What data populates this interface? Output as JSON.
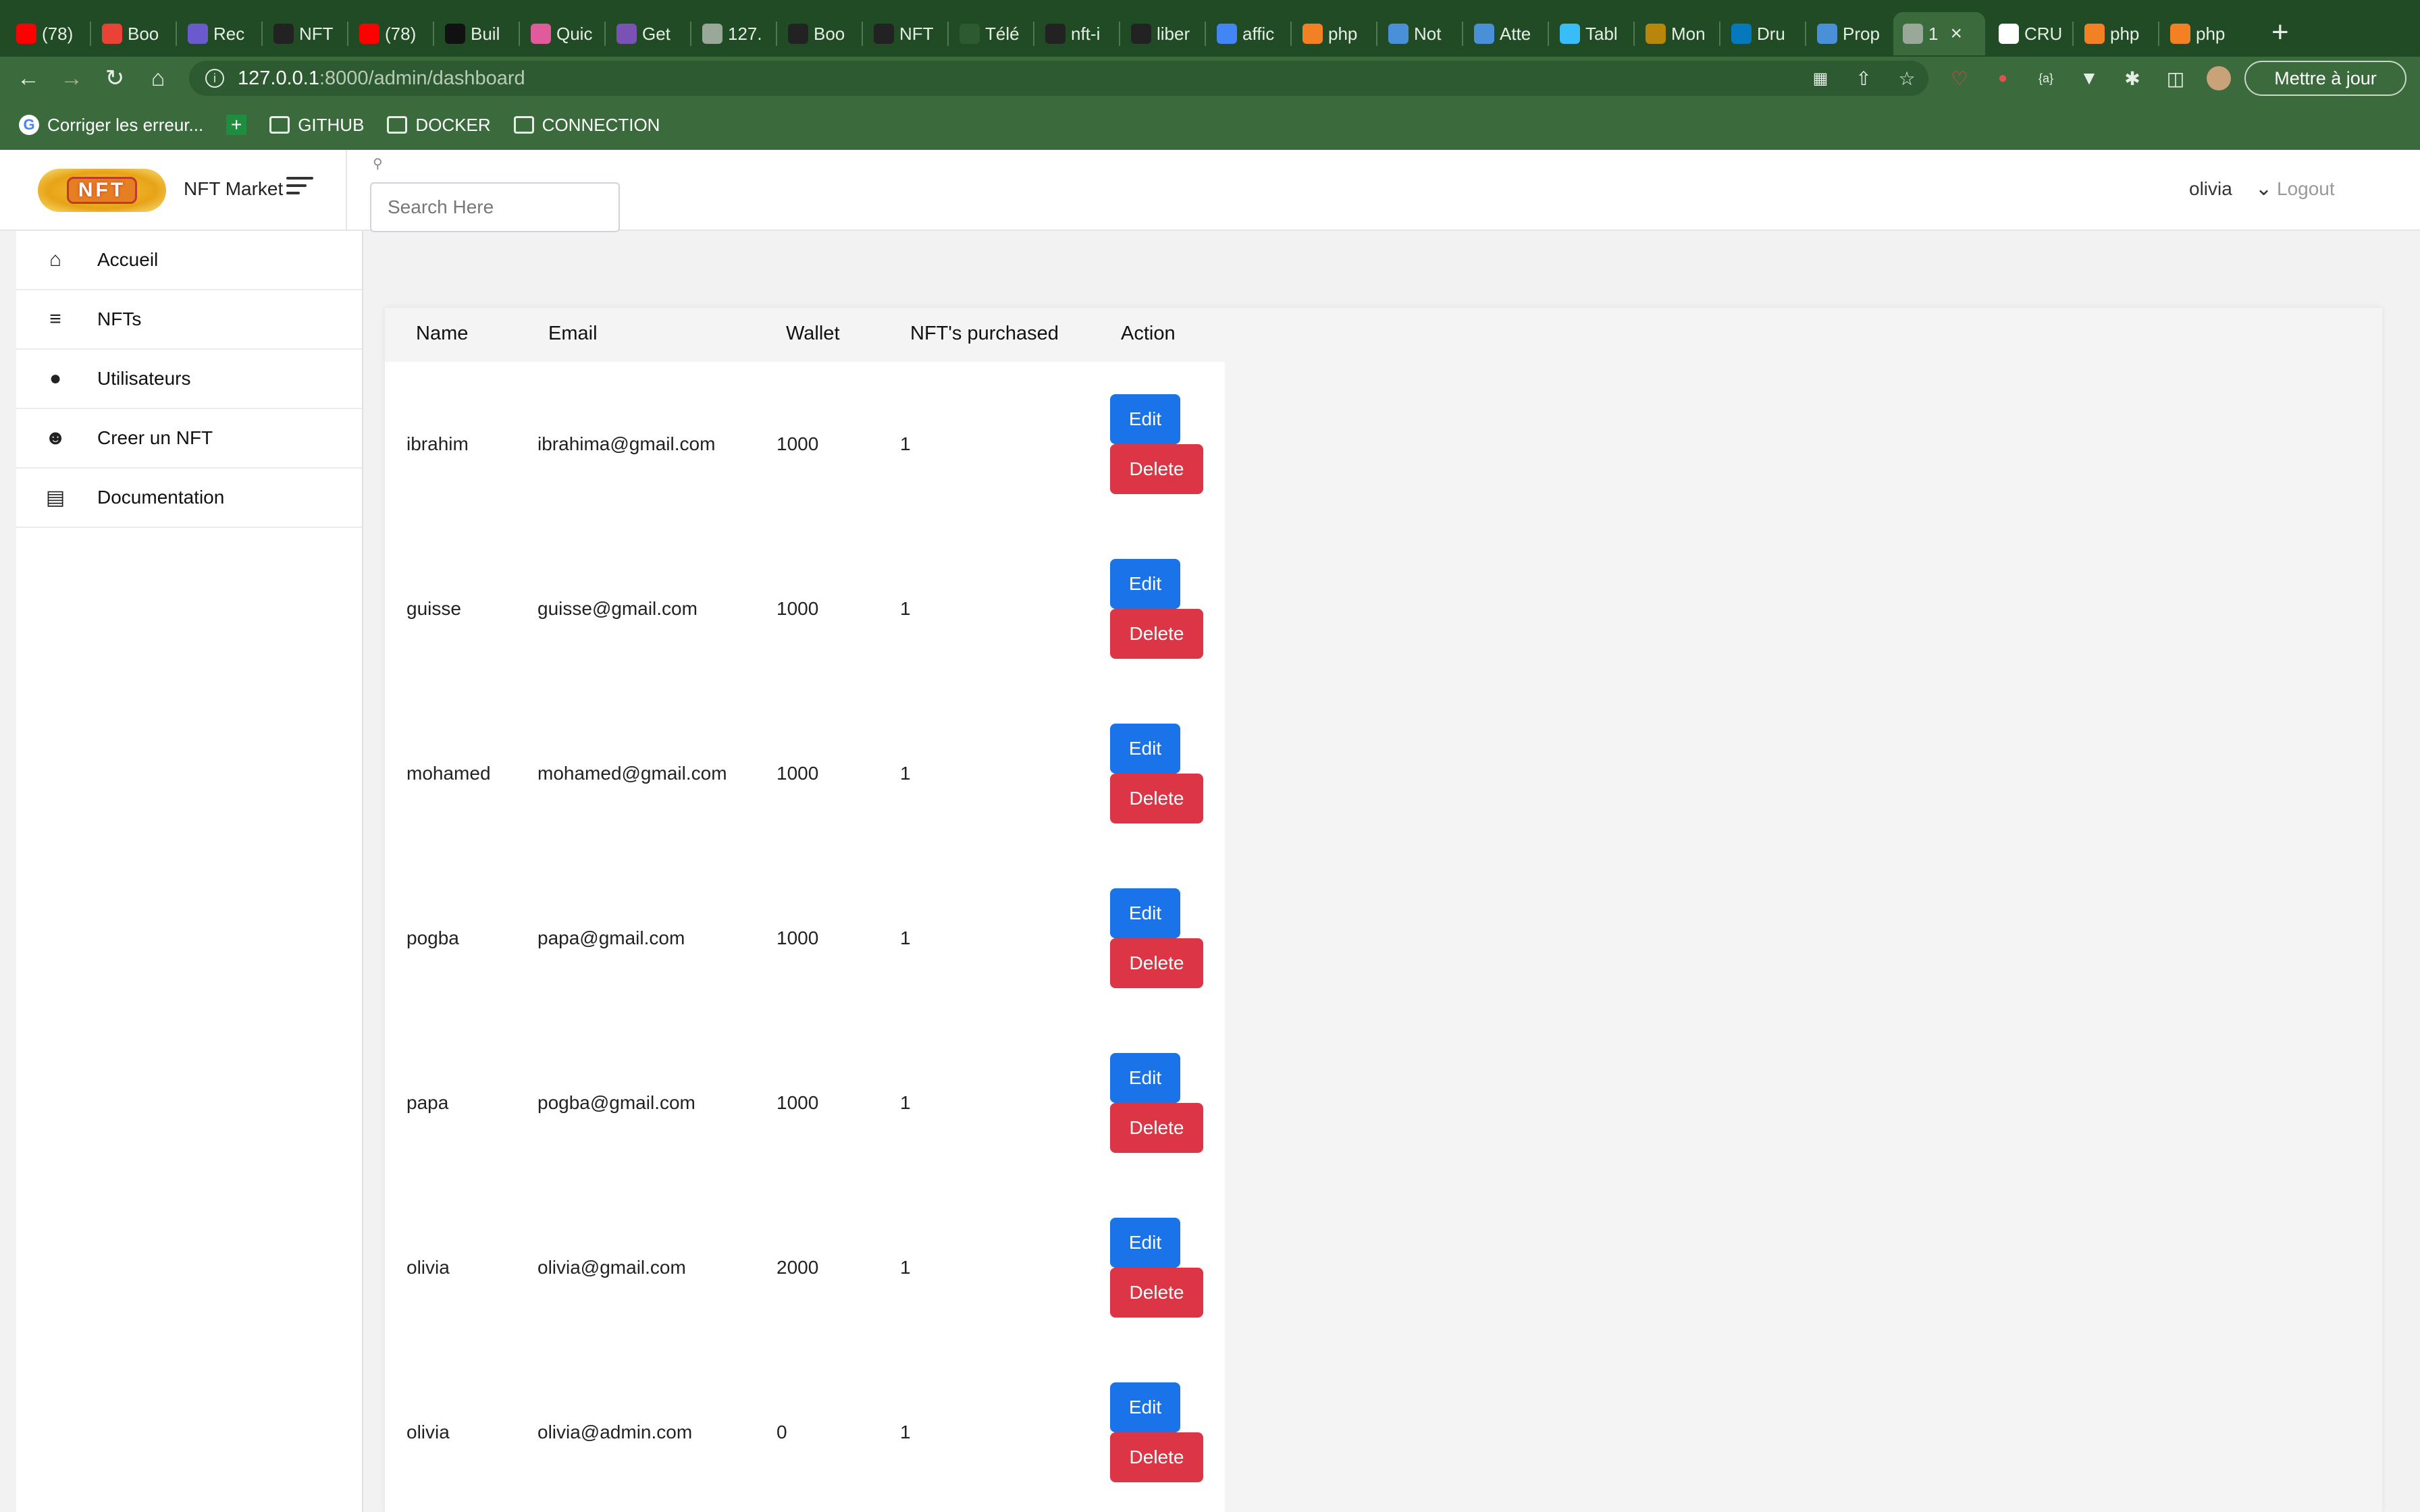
{
  "browser": {
    "tabs": [
      {
        "label": "(78)",
        "icon": "youtube-icon",
        "color": "#ff0000"
      },
      {
        "label": "Boo",
        "icon": "gmail-icon",
        "color": "#ea4335"
      },
      {
        "label": "Rec",
        "icon": "app-icon",
        "color": "#6a5acd"
      },
      {
        "label": "NFT",
        "icon": "github-icon",
        "color": "#222222"
      },
      {
        "label": "(78)",
        "icon": "youtube-icon",
        "color": "#ff0000"
      },
      {
        "label": "Buil",
        "icon": "build-icon",
        "color": "#111111"
      },
      {
        "label": "Quic",
        "icon": "quick-icon",
        "color": "#e05a9c"
      },
      {
        "label": "Get",
        "icon": "bootstrap-icon",
        "color": "#7952b3"
      },
      {
        "label": "127.",
        "icon": "page-icon",
        "color": "#9aa89a"
      },
      {
        "label": "Boo",
        "icon": "github-icon",
        "color": "#222222"
      },
      {
        "label": "NFT",
        "icon": "github-icon",
        "color": "#222222"
      },
      {
        "label": "Télé",
        "icon": "download-icon",
        "color": "#2d5a30"
      },
      {
        "label": "nft-i",
        "icon": "github-icon",
        "color": "#222222"
      },
      {
        "label": "liber",
        "icon": "github-icon",
        "color": "#222222"
      },
      {
        "label": "affic",
        "icon": "google-icon",
        "color": "#4285f4"
      },
      {
        "label": "php",
        "icon": "stackoverflow-icon",
        "color": "#f48024"
      },
      {
        "label": "Not",
        "icon": "tool-icon",
        "color": "#4a90d9"
      },
      {
        "label": "Atte",
        "icon": "tool-icon",
        "color": "#4a90d9"
      },
      {
        "label": "Tabl",
        "icon": "tailwind-icon",
        "color": "#38bdf8"
      },
      {
        "label": "Mon",
        "icon": "app-icon",
        "color": "#b8860b"
      },
      {
        "label": "Dru",
        "icon": "drupal-icon",
        "color": "#0678be"
      },
      {
        "label": "Prop",
        "icon": "tool-icon",
        "color": "#4a90d9"
      },
      {
        "label": "1",
        "icon": "page-icon",
        "color": "#9aa89a",
        "active": true
      },
      {
        "label": "CRU",
        "icon": "chat-icon",
        "color": "#ffffff"
      },
      {
        "label": "php",
        "icon": "stackoverflow-icon",
        "color": "#f48024"
      },
      {
        "label": "php",
        "icon": "stackoverflow-icon",
        "color": "#f48024"
      }
    ],
    "url_host": "127.0.0.1",
    "url_path": ":8000/admin/dashboard",
    "update_label": "Mettre à jour",
    "bookmarks": [
      {
        "label": "Corriger les erreur...",
        "icon": "google-icon"
      },
      {
        "label": "",
        "icon": "sheets-icon"
      },
      {
        "label": "GITHUB",
        "icon": "folder-icon"
      },
      {
        "label": "DOCKER",
        "icon": "folder-icon"
      },
      {
        "label": "CONNECTION",
        "icon": "folder-icon"
      }
    ]
  },
  "header": {
    "logo_text": "NFT",
    "brand_name": "NFT Market",
    "search_placeholder": "Search Here",
    "username": "olivia",
    "logout_label": "Logout"
  },
  "sidebar": {
    "items": [
      {
        "label": "Accueil",
        "icon": "home-icon"
      },
      {
        "label": "NFTs",
        "icon": "list-icon"
      },
      {
        "label": "Utilisateurs",
        "icon": "user-icon"
      },
      {
        "label": "Creer un NFT",
        "icon": "smiley-icon"
      },
      {
        "label": "Documentation",
        "icon": "document-icon"
      }
    ]
  },
  "table": {
    "columns": [
      "Name",
      "Email",
      "Wallet",
      "NFT's purchased",
      "Action"
    ],
    "edit_label": "Edit",
    "delete_label": "Delete",
    "rows": [
      {
        "name": "ibrahim",
        "email": "ibrahima@gmail.com",
        "wallet": "1000",
        "purchased": "1"
      },
      {
        "name": "guisse",
        "email": "guisse@gmail.com",
        "wallet": "1000",
        "purchased": "1"
      },
      {
        "name": "mohamed",
        "email": "mohamed@gmail.com",
        "wallet": "1000",
        "purchased": "1"
      },
      {
        "name": "pogba",
        "email": "papa@gmail.com",
        "wallet": "1000",
        "purchased": "1"
      },
      {
        "name": "papa",
        "email": "pogba@gmail.com",
        "wallet": "1000",
        "purchased": "1"
      },
      {
        "name": "olivia",
        "email": "olivia@gmail.com",
        "wallet": "2000",
        "purchased": "1"
      },
      {
        "name": "olivia",
        "email": "olivia@admin.com",
        "wallet": "0",
        "purchased": "1"
      }
    ]
  },
  "colors": {
    "browser_frame": "#204b24",
    "edit_button": "#1a73e8",
    "delete_button": "#dc3545"
  }
}
